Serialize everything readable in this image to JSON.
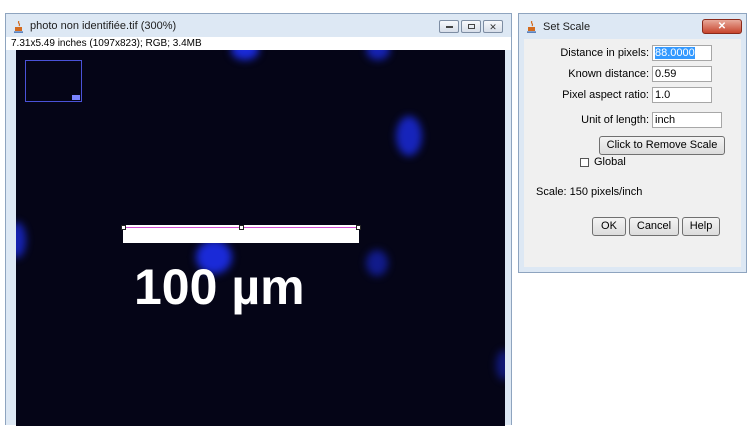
{
  "image_window": {
    "title": "photo non identifiée.tif (300%)",
    "info": "7.31x5.49 inches (1097x823); RGB; 3.4MB",
    "close_glyph": "✕",
    "scale_bar_label": "100 µm"
  },
  "dialog": {
    "title": "Set Scale",
    "close_glyph": "✕",
    "distance_label": "Distance in pixels:",
    "distance_value": "88.0000",
    "known_label": "Known distance:",
    "known_value": "0.59",
    "aspect_label": "Pixel aspect ratio:",
    "aspect_value": "1.0",
    "unit_label": "Unit of length:",
    "unit_value": "inch",
    "remove_scale_label": "Click to Remove Scale",
    "global_label": "Global",
    "global_checked": false,
    "scale_text": "Scale: 150 pixels/inch",
    "ok_label": "OK",
    "cancel_label": "Cancel",
    "help_label": "Help"
  },
  "colors": {
    "image_background": "#050517",
    "blob": "#1a2ad8",
    "selection_line": "#d24fd2",
    "close_button": "#c7452e",
    "text_selection": "#3399ff"
  },
  "icons": {
    "app": "java-cup-icon",
    "minimize": "minimize-icon",
    "maximize": "maximize-icon",
    "close": "close-icon"
  }
}
